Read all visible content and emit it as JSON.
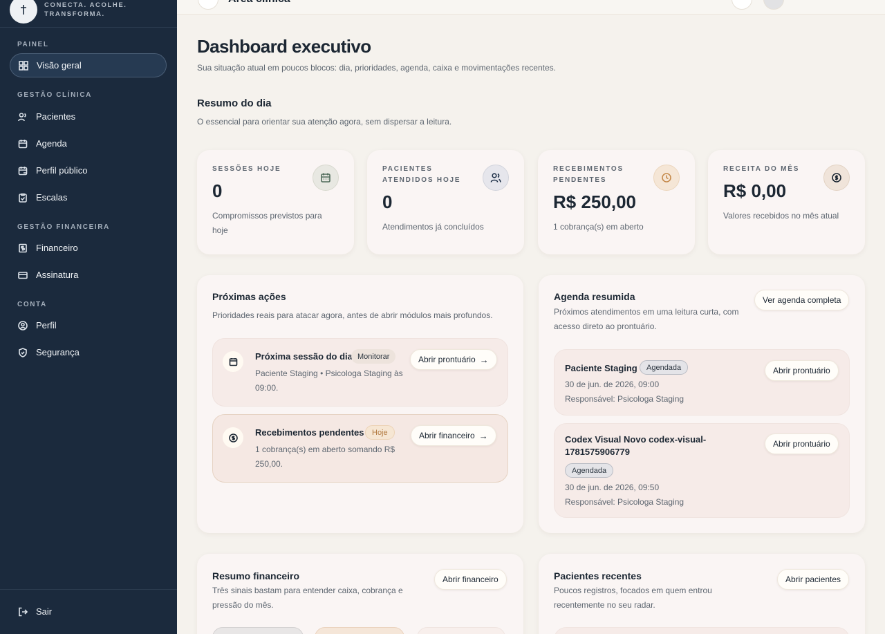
{
  "brand": {
    "tagline_line1": "CONECTA. ACOLHE.",
    "tagline_line2": "TRANSFORMA."
  },
  "sidebar": {
    "sections": [
      {
        "label": "PAINEL"
      },
      {
        "label": "GESTÃO CLÍNICA"
      },
      {
        "label": "GESTÃO FINANCEIRA"
      },
      {
        "label": "CONTA"
      }
    ],
    "items": [
      {
        "label": "Visão geral",
        "icon": "grid-icon",
        "active": true
      },
      {
        "label": "Pacientes",
        "icon": "users-icon"
      },
      {
        "label": "Agenda",
        "icon": "calendar-icon"
      },
      {
        "label": "Perfil público",
        "icon": "calendar-user-icon"
      },
      {
        "label": "Escalas",
        "icon": "clipboard-icon"
      },
      {
        "label": "Financeiro",
        "icon": "receipt-icon"
      },
      {
        "label": "Assinatura",
        "icon": "credit-card-icon"
      },
      {
        "label": "Perfil",
        "icon": "user-circle-icon"
      },
      {
        "label": "Segurança",
        "icon": "shield-icon"
      }
    ],
    "logout_label": "Sair"
  },
  "topbar": {
    "title": "Área clínica"
  },
  "page": {
    "title": "Dashboard executivo",
    "subtitle": "Sua situação atual em poucos blocos: dia, prioridades, agenda, caixa e movimentações recentes."
  },
  "summary": {
    "title": "Resumo do dia",
    "subtitle": "O essencial para orientar sua atenção agora, sem dispersar a leitura.",
    "cards": [
      {
        "label": "SESSÕES HOJE",
        "value": "0",
        "note": "Compromissos previstos para hoje",
        "icon": "calendar-icon"
      },
      {
        "label": "PACIENTES ATENDIDOS HOJE",
        "value": "0",
        "note": "Atendimentos já concluídos",
        "icon": "users-icon"
      },
      {
        "label": "RECEBIMENTOS PENDENTES",
        "value": "R$ 250,00",
        "note": "1 cobrança(s) em aberto",
        "icon": "clock-icon"
      },
      {
        "label": "RECEITA DO MÊS",
        "value": "R$ 0,00",
        "note": "Valores recebidos no mês atual",
        "icon": "dollar-icon"
      }
    ]
  },
  "next_actions": {
    "title": "Próximas ações",
    "subtitle": "Prioridades reais para atacar agora, antes de abrir módulos mais profundos.",
    "items": [
      {
        "title": "Próxima sessão do dia",
        "badge": "Monitorar",
        "text": "Paciente Staging • Psicologa Staging às 09:00.",
        "button": "Abrir prontuário"
      },
      {
        "title": "Recebimentos pendentes",
        "badge": "Hoje",
        "text": "1 cobrança(s) em aberto somando R$ 250,00.",
        "button": "Abrir financeiro"
      }
    ]
  },
  "agenda": {
    "title": "Agenda resumida",
    "subtitle": "Próximos atendimentos em uma leitura curta, com acesso direto ao prontuário.",
    "button": "Ver agenda completa",
    "items": [
      {
        "name": "Paciente Staging",
        "badge": "Agendada",
        "date": "30 de jun. de 2026, 09:00",
        "responsible": "Responsável: Psicologa Staging",
        "button": "Abrir prontuário"
      },
      {
        "name": "Codex Visual Novo codex-visual-1781575906779",
        "badge": "Agendada",
        "date": "30 de jun. de 2026, 09:50",
        "responsible": "Responsável: Psicologa Staging",
        "button": "Abrir prontuário"
      }
    ]
  },
  "finance": {
    "title": "Resumo financeiro",
    "subtitle": "Três sinais bastam para entender caixa, cobrança e pressão do mês.",
    "button": "Abrir financeiro"
  },
  "recent_patients": {
    "title": "Pacientes recentes",
    "subtitle": "Poucos registros, focados em quem entrou recentemente no seu radar.",
    "button": "Abrir pacientes"
  },
  "colors": {
    "sidebar_bg": "#1b2a3d",
    "page_bg": "#f5f2ed",
    "card_bg": "#faf5f4",
    "warn_accent": "#b27a40"
  }
}
